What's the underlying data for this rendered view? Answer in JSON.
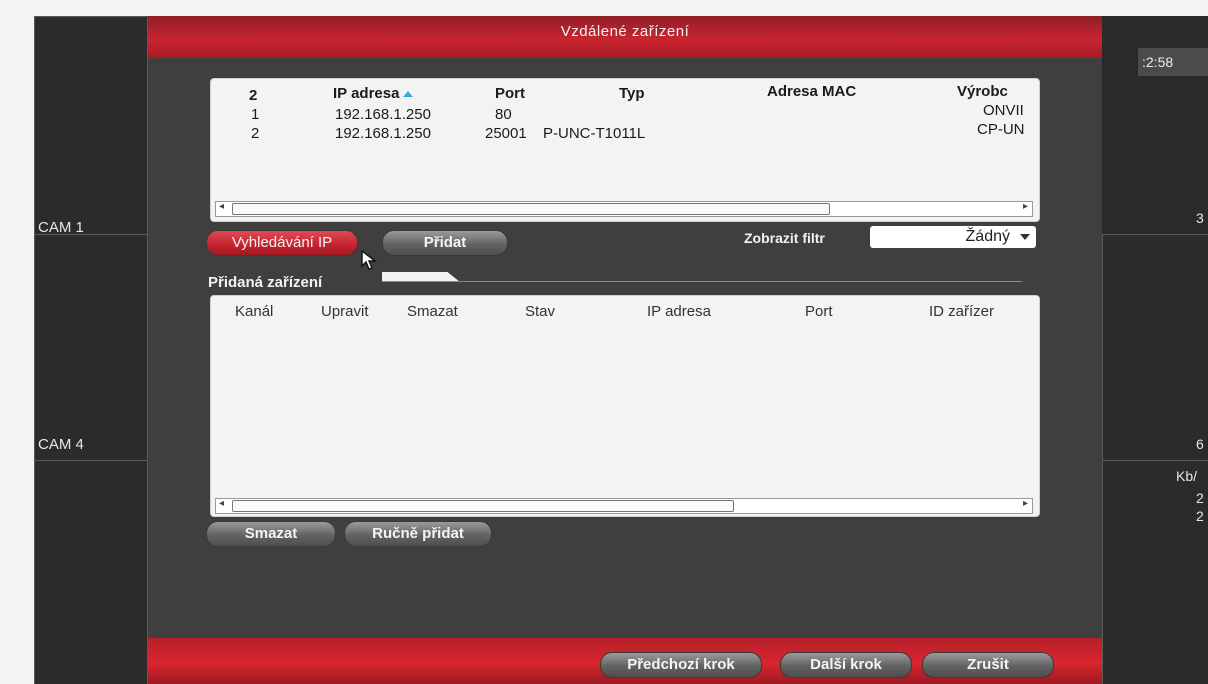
{
  "monitor": {
    "cam_labels": [
      "CAM 1",
      "CAM 4"
    ],
    "clock_fragment": ":2:58",
    "right_edge_texts": [
      "3",
      "6",
      "Kb/",
      "2",
      "2"
    ]
  },
  "dialog": {
    "title": "Vzdálené zařízení",
    "search_table": {
      "count": "2",
      "columns": [
        "IP adresa",
        "Port",
        "Typ",
        "Adresa MAC",
        "Výrobc"
      ],
      "rows": [
        {
          "no": "1",
          "ip": "192.168.1.250",
          "port": "80",
          "type": "",
          "mac": "",
          "vendor": "ONVII"
        },
        {
          "no": "2",
          "ip": "192.168.1.250",
          "port": "25001",
          "type": "P-UNC-T1011L",
          "mac": "",
          "vendor": "CP-UN"
        }
      ]
    },
    "buttons": {
      "search_ip": "Vyhledávání IP",
      "add": "Přidat",
      "delete": "Smazat",
      "manual_add": "Ručně přidat"
    },
    "filter": {
      "label": "Zobrazit filtr",
      "value": "Žádný"
    },
    "added_section": {
      "label": "Přidaná zařízení",
      "columns": [
        "Kanál",
        "Upravit",
        "Smazat",
        "Stav",
        "IP adresa",
        "Port",
        "ID zařízer"
      ]
    },
    "footer": {
      "prev": "Předchozí krok",
      "next": "Další krok",
      "cancel": "Zrušit"
    }
  }
}
